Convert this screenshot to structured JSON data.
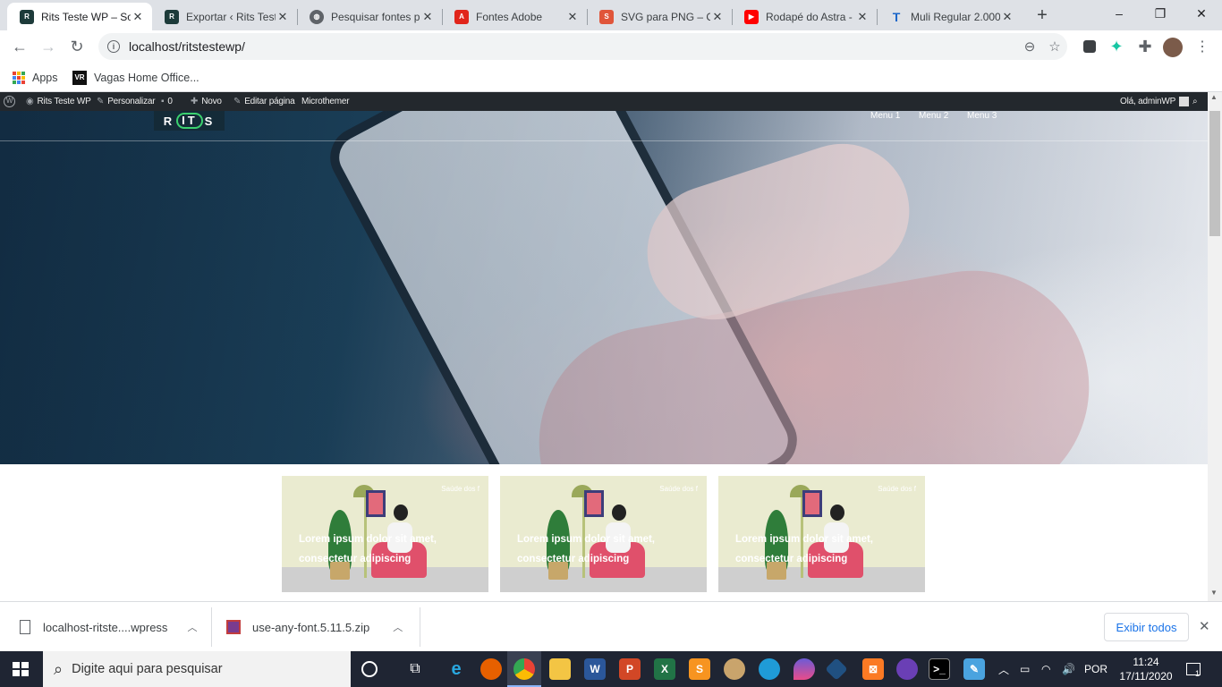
{
  "browser": {
    "tabs": [
      {
        "title": "Rits Teste WP – So",
        "icon": "wordpress-site-icon",
        "color": "#1d3b3a"
      },
      {
        "title": "Exportar ‹ Rits Test",
        "icon": "wordpress-site-icon",
        "color": "#1d3b3a"
      },
      {
        "title": "Pesquisar fontes p",
        "icon": "globe-icon",
        "color": "#5f6368"
      },
      {
        "title": "Fontes Adobe",
        "icon": "adobe-icon",
        "color": "#e1251b"
      },
      {
        "title": "SVG para PNG – C",
        "icon": "svg-png-icon",
        "color": "#e0553a"
      },
      {
        "title": "Rodapé do Astra -",
        "icon": "youtube-icon",
        "color": "#ff0000"
      },
      {
        "title": "Muli Regular 2.000",
        "icon": "t-letter-icon",
        "color": "#1b66c9"
      }
    ],
    "new_tab": "+",
    "window": {
      "minimize": "–",
      "restore": "❐",
      "close": "✕"
    },
    "url": "localhost/ritstestewp/",
    "bookmarks": [
      {
        "label": "Apps"
      },
      {
        "label": "Vagas Home Office..."
      }
    ]
  },
  "wp_admin_bar": {
    "site": "Rits Teste WP",
    "customize": "Personalizar",
    "comments": "0",
    "new": "Novo",
    "edit": "Editar página",
    "microthemer": "Microthemer",
    "greeting": "Olá, adminWP"
  },
  "site": {
    "logo": {
      "pre": "R",
      "mid": "IT",
      "post": "S"
    },
    "menu": [
      "Menu 1",
      "Menu 2",
      "Menu 3"
    ],
    "cards": [
      {
        "tag": "Saúde dos f",
        "text": "Lorem ipsum dolor sit amet, consectetur adipiscing"
      },
      {
        "tag": "Saúde dos f",
        "text": "Lorem ipsum dolor sit amet, consectetur adipiscing"
      },
      {
        "tag": "Saúde dos f",
        "text": "Lorem ipsum dolor sit amet, consectetur adipiscing"
      }
    ]
  },
  "downloads": {
    "items": [
      {
        "name": "localhost-ritste....wpress"
      },
      {
        "name": "use-any-font.5.11.5.zip"
      }
    ],
    "show_all": "Exibir todos"
  },
  "taskbar": {
    "search_placeholder": "Digite aqui para pesquisar",
    "apps": [
      "cortana",
      "task-view",
      "ie",
      "firefox",
      "chrome",
      "explorer",
      "word",
      "powerpoint",
      "excel",
      "sublime",
      "paint",
      "edge",
      "droplet",
      "sourcetree",
      "xampp",
      "app-purple",
      "terminal",
      "notepad"
    ],
    "language": "POR",
    "time": "11:24",
    "date": "17/11/2020",
    "notifications": "1"
  }
}
